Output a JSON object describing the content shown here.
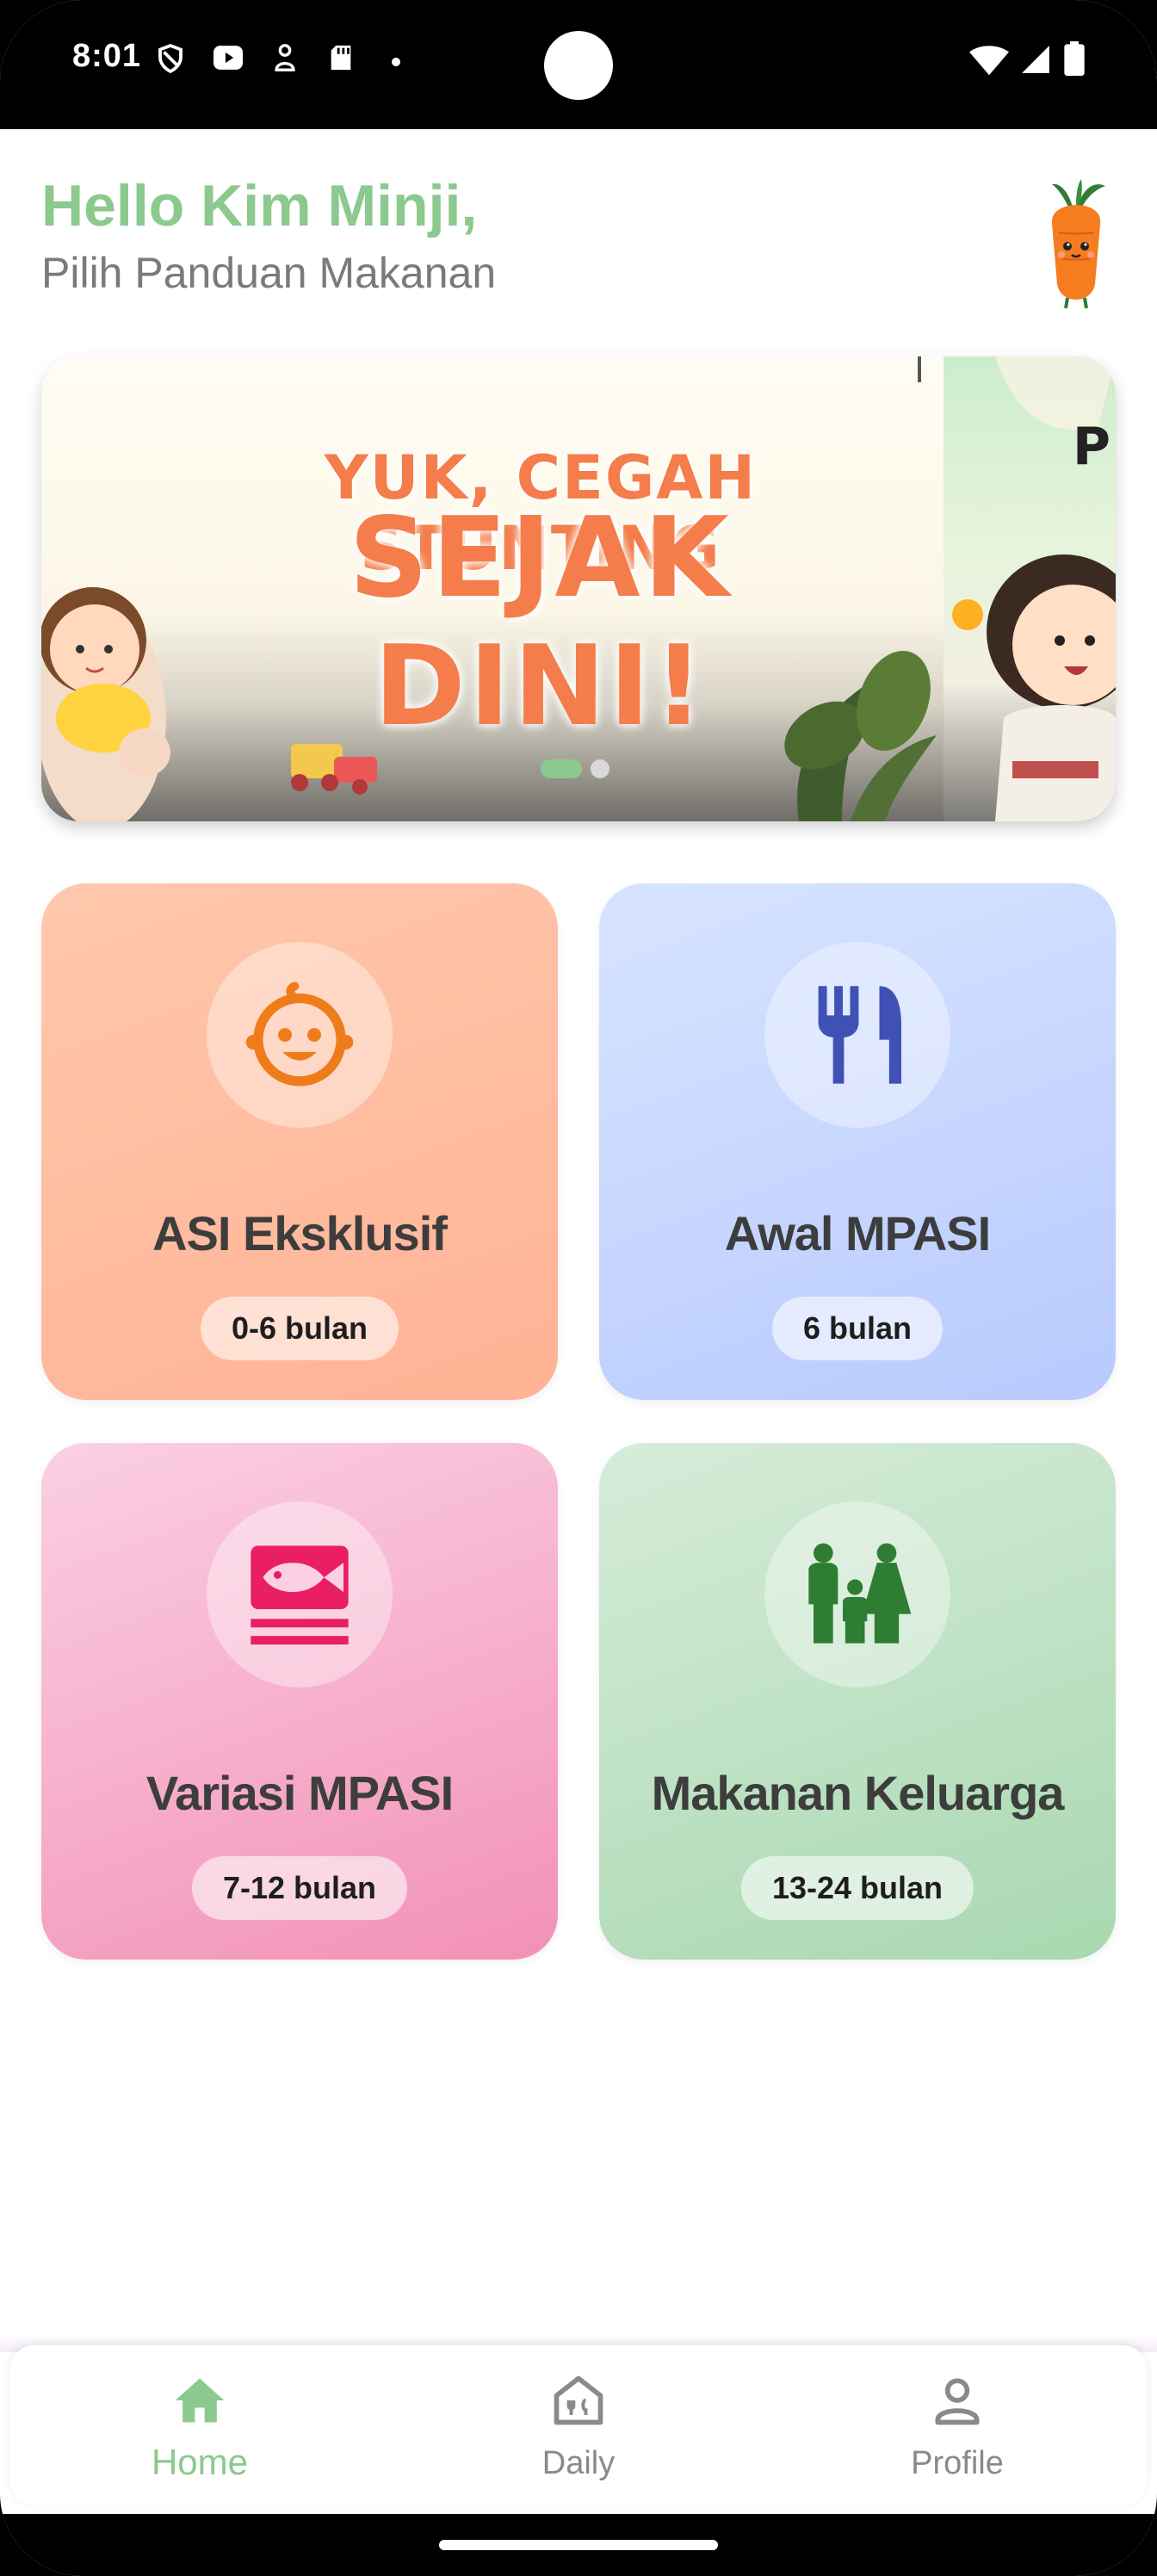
{
  "status_bar": {
    "time": "8:01"
  },
  "header": {
    "greeting": "Hello Kim Minji,",
    "subtitle": "Pilih Panduan Makanan"
  },
  "banner": {
    "line1": "YUK, CEGAH STUNTING",
    "line2": "SEJAK DINI!",
    "next_slide_letter": "P",
    "slides_total": 2,
    "active_slide": 1
  },
  "cards": [
    {
      "title": "ASI Eksklusif",
      "badge": "0-6 bulan",
      "icon": "baby-face-icon",
      "icon_color": "#ef7c1a"
    },
    {
      "title": "Awal MPASI",
      "badge": "6 bulan",
      "icon": "fork-knife-icon",
      "icon_color": "#3f51b5"
    },
    {
      "title": "Variasi MPASI",
      "badge": "7-12 bulan",
      "icon": "fish-icon",
      "icon_color": "#e91e63"
    },
    {
      "title": "Makanan Keluarga",
      "badge": "13-24 bulan",
      "icon": "family-icon",
      "icon_color": "#2e7d32"
    }
  ],
  "bottom_nav": {
    "items": [
      {
        "label": "Home",
        "icon": "home-icon",
        "active": true
      },
      {
        "label": "Daily",
        "icon": "daily-food-icon",
        "active": false
      },
      {
        "label": "Profile",
        "icon": "person-icon",
        "active": false
      }
    ],
    "active_color": "#8cc98e",
    "inactive_color": "#8a8a8a"
  }
}
